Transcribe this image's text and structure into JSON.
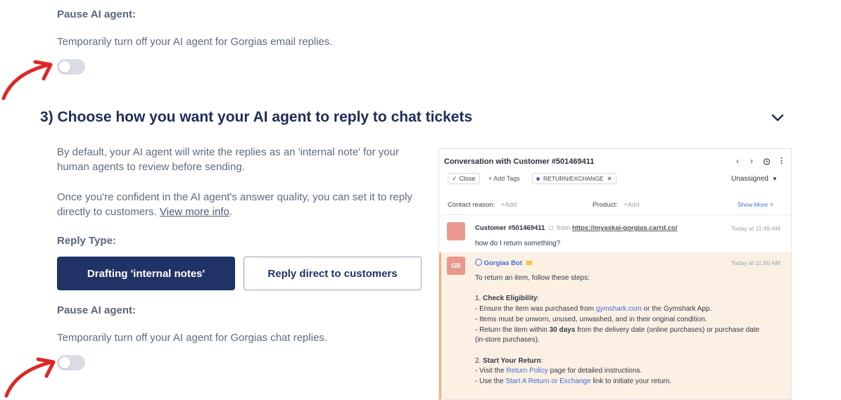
{
  "email_section": {
    "pause_label": "Pause AI agent:",
    "pause_desc": "Temporarily turn off your AI agent for Gorgias email replies."
  },
  "chat_section": {
    "title": "3) Choose how you want your AI agent to reply to chat tickets",
    "desc1_line1": "By default, your AI agent will write the replies as an 'internal note' for your",
    "desc1_line2": "human agents to review before sending.",
    "desc2_line1": "Once you're confident in the AI agent's answer quality, you can set it to reply",
    "desc2_line2_prefix": "directly to customers. ",
    "desc2_link": "View more info",
    "desc2_suffix": ".",
    "reply_type_label": "Reply Type:",
    "btn_drafting": "Drafting 'internal notes'",
    "btn_direct": "Reply direct to customers",
    "pause_label": "Pause AI agent:",
    "pause_desc": "Temporarily turn off your AI agent for Gorgias chat replies."
  },
  "conversation": {
    "title": "Conversation with Customer #501469411",
    "close_label": "Close",
    "add_tags_label": "Add Tags",
    "tag_label": "RETURN/EXCHANGE",
    "assignee": "Unassigned",
    "contact_reason_label": "Contact reason:",
    "contact_reason_placeholder": "+Add",
    "product_label": "Product:",
    "product_placeholder": "+Add",
    "show_more": "Show More",
    "customer_msg": {
      "name": "Customer #501469411",
      "from_text": "from",
      "source_url": "https://myaskai-gorgias.carrd.co/",
      "time": "Today at 11:49 AM",
      "text": "how do I return something?"
    },
    "bot_msg": {
      "avatar_initials": "GB",
      "name": "Gorgias Bot",
      "time": "Today at 11:50 AM",
      "intro": "To return an item, follow these steps:",
      "step1_title_prefix": "1. ",
      "step1_title": "Check Eligibility",
      "step1_title_suffix": ":",
      "b1_prefix": "- Ensure the item was purchased from ",
      "b1_link": "gymshark.com",
      "b1_suffix": " or the Gymshark App.",
      "b2": "- Items must be unworn, unused, unwashed, and in their original condition.",
      "b3_prefix": "- Return the item within ",
      "b3_bold": "30 days",
      "b3_suffix": " from the delivery date (online purchases) or purchase date",
      "b3_line2": "(in-store purchases).",
      "step2_title_prefix": "2. ",
      "step2_title": "Start Your Return",
      "step2_title_suffix": ":",
      "b4_prefix": "- Visit the ",
      "b4_link": "Return Policy",
      "b4_suffix": " page for detailed instructions.",
      "b5_prefix": "- Use the ",
      "b5_link": "Start A Return or Exchange",
      "b5_suffix": " link to initiate your return."
    }
  },
  "colors": {
    "primary": "#213366",
    "annotation_arrow": "#e02525",
    "bot_bg": "#fcefe4",
    "bot_accent": "#f2b37a",
    "link": "#3f6fd8"
  }
}
